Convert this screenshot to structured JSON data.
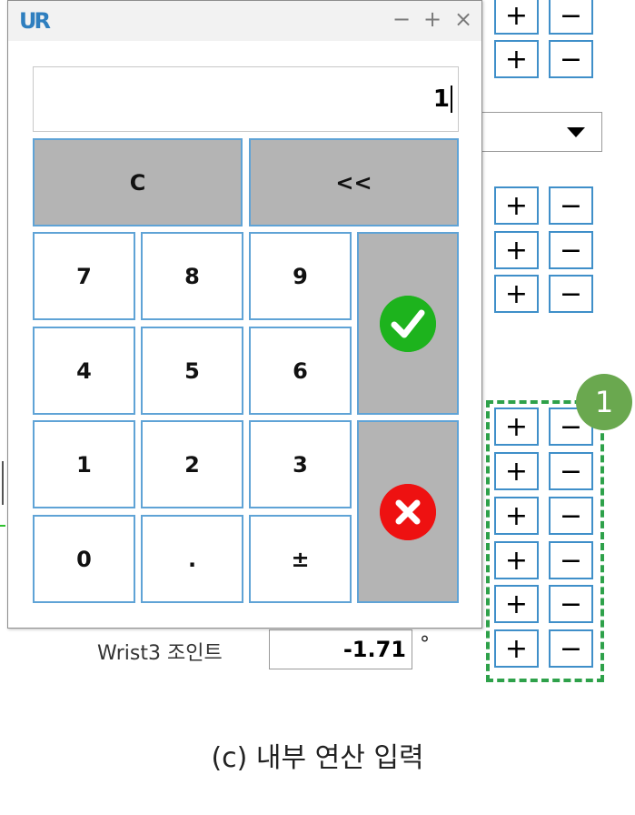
{
  "calculator": {
    "logo": "UR",
    "window_controls": [
      "−",
      "+",
      "×"
    ],
    "display_value": "1",
    "keys": {
      "clear": "C",
      "backspace": "<<",
      "k7": "7",
      "k8": "8",
      "k9": "9",
      "k4": "4",
      "k5": "5",
      "k6": "6",
      "k1": "1",
      "k2": "2",
      "k3": "3",
      "k0": "0",
      "dot": ".",
      "sign": "±"
    },
    "ok_icon": "checkmark-icon",
    "cancel_icon": "cancel-x-icon"
  },
  "steppers": {
    "plus": "+",
    "minus": "−"
  },
  "wrist3": {
    "label": "Wrist3 조인트",
    "value": "-1.71",
    "unit": "°"
  },
  "badge": "1",
  "caption": "(c) 내부 연산 입력",
  "colors": {
    "key_border": "#5fa3d6",
    "gray_key": "#b4b4b4",
    "ok_green": "#1db31d",
    "cancel_red": "#ee1111",
    "highlight_green": "#2ea14a",
    "badge_green": "#6aa84f"
  }
}
